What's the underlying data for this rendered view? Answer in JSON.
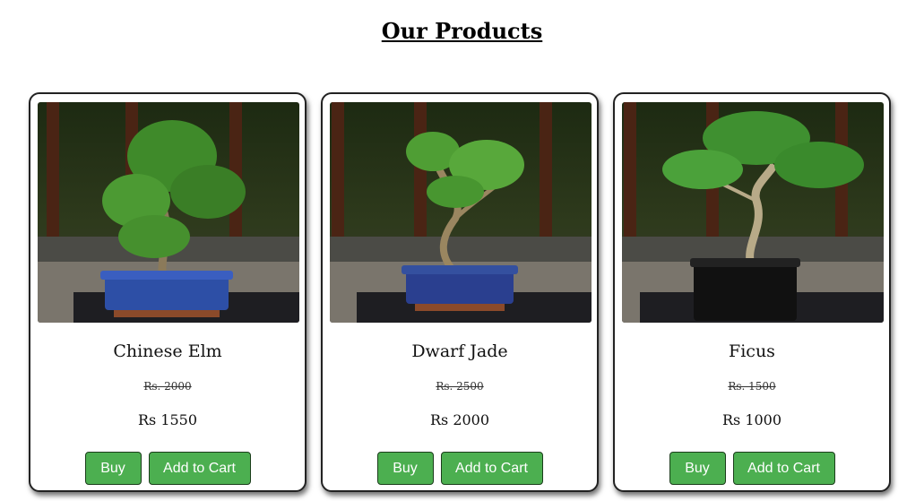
{
  "page": {
    "heading": "Our Products"
  },
  "products": [
    {
      "name": "Chinese Elm",
      "old_price": "Rs. 2000",
      "price": "Rs 1550",
      "buy_label": "Buy",
      "cart_label": "Add to Cart",
      "pot_color": "#2d4fa6"
    },
    {
      "name": "Dwarf Jade",
      "old_price": "Rs. 2500",
      "price": "Rs 2000",
      "buy_label": "Buy",
      "cart_label": "Add to Cart",
      "pot_color": "#2a3f8f"
    },
    {
      "name": "Ficus",
      "old_price": "Rs. 1500",
      "price": "Rs 1000",
      "buy_label": "Buy",
      "cart_label": "Add to Cart",
      "pot_color": "#111111"
    }
  ],
  "colors": {
    "button": "#4caf50",
    "card_border": "#222222"
  }
}
